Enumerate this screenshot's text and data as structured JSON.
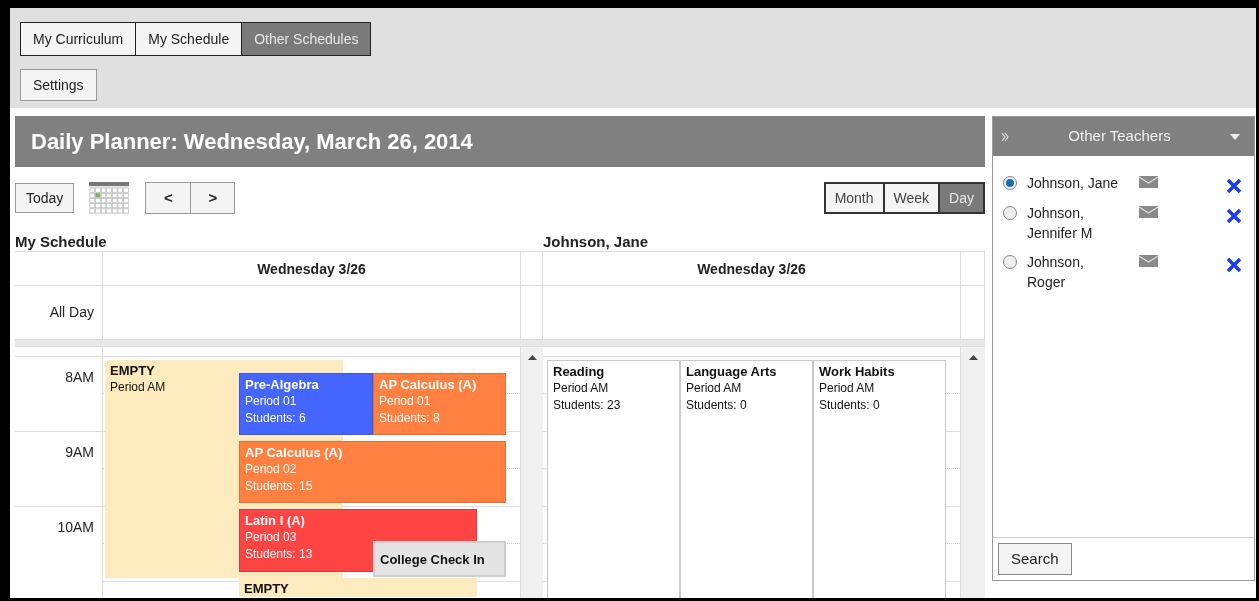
{
  "tabs": [
    {
      "label": "My Curriculum",
      "selected": false
    },
    {
      "label": "My Schedule",
      "selected": false
    },
    {
      "label": "Other Schedules",
      "selected": true
    }
  ],
  "settings_button": "Settings",
  "planner": {
    "title": "Daily Planner: Wednesday, March 26, 2014",
    "toolbar": {
      "today": "Today",
      "prev": "<",
      "next": ">",
      "views": [
        {
          "label": "Month",
          "selected": false
        },
        {
          "label": "Week",
          "selected": false
        },
        {
          "label": "Day",
          "selected": true
        }
      ]
    },
    "schedules": [
      {
        "title": "My Schedule",
        "day_header": "Wednesday 3/26",
        "all_day_label": "All Day",
        "hours": [
          "8AM",
          "9AM",
          "10AM"
        ],
        "events": [
          {
            "kind": "empty",
            "color": "#fdebbf",
            "title": "EMPTY",
            "lines": [
              "Period AM"
            ]
          },
          {
            "kind": "class",
            "color": "#4466ff",
            "title": "Pre-Algebra",
            "lines": [
              "Period 01",
              "Students: 6"
            ]
          },
          {
            "kind": "class",
            "color": "#ff8040",
            "title": "AP Calculus (A)",
            "lines": [
              "Period 01",
              "Students: 8"
            ]
          },
          {
            "kind": "class",
            "color": "#ff8040",
            "title": "AP Calculus (A)",
            "lines": [
              "Period 02",
              "Students: 15"
            ]
          },
          {
            "kind": "class",
            "color": "#ff4444",
            "title": "Latin I (A)",
            "lines": [
              "Period 03",
              "Students: 13"
            ]
          },
          {
            "kind": "note",
            "color": "#e4e4e4",
            "title": "College Check In"
          },
          {
            "kind": "empty",
            "color": "#fdebbf",
            "title": "EMPTY"
          }
        ]
      },
      {
        "title": "Johnson, Jane",
        "day_header": "Wednesday 3/26",
        "events": [
          {
            "kind": "plain",
            "color": "#ffffff",
            "title": "Reading",
            "lines": [
              "Period AM",
              "Students: 23"
            ]
          },
          {
            "kind": "plain",
            "color": "#ffffff",
            "title": "Language Arts",
            "lines": [
              "Period AM",
              "Students: 0"
            ]
          },
          {
            "kind": "plain",
            "color": "#ffffff",
            "title": "Work Habits",
            "lines": [
              "Period AM",
              "Students: 0"
            ]
          }
        ]
      }
    ]
  },
  "side_panel": {
    "title": "Other Teachers",
    "teachers": [
      {
        "name": "Johnson, Jane",
        "selected": true
      },
      {
        "name": "Johnson, Jennifer M",
        "selected": false
      },
      {
        "name": "Johnson, Roger",
        "selected": false
      }
    ],
    "search_button": "Search"
  }
}
